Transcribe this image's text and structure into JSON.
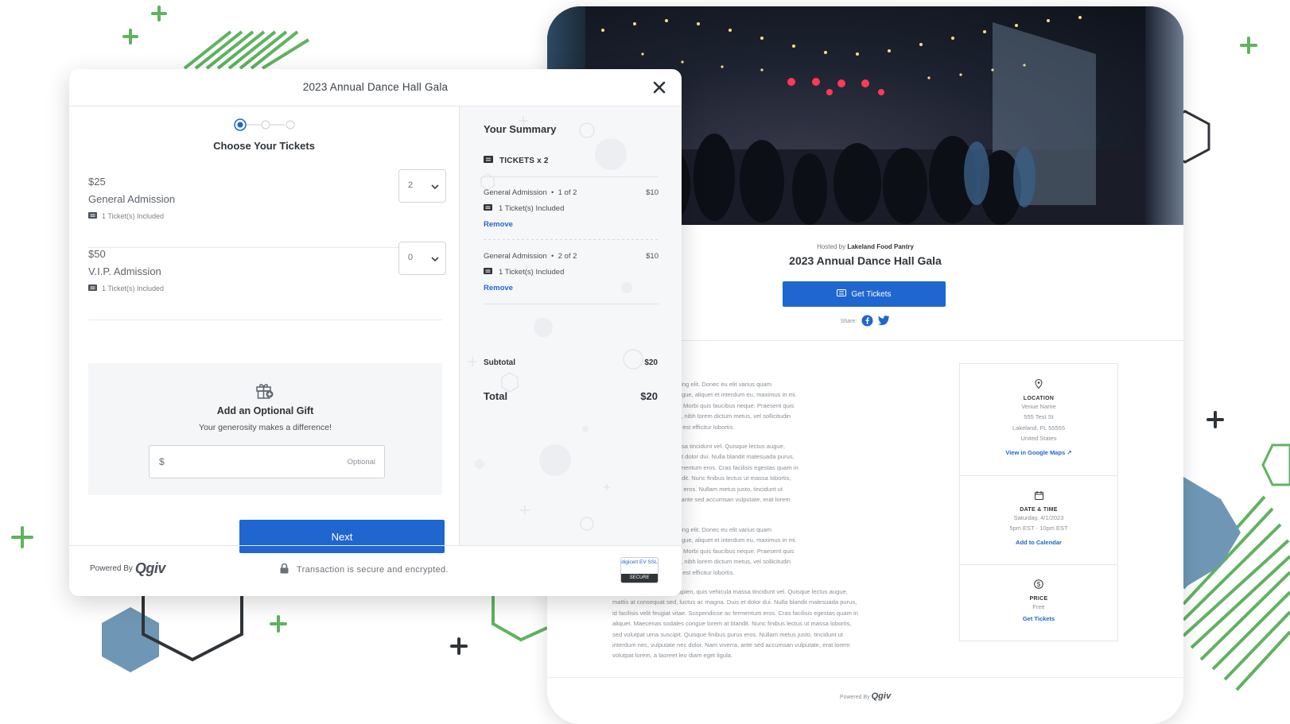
{
  "colors": {
    "accent": "#1f66d1",
    "green_deco": "#5fb35f",
    "hex_blue": "#6f97b5"
  },
  "event_page": {
    "hosted_prefix": "Hosted by",
    "host_name": "Lakeland Food Pantry",
    "title": "2023 Annual Dance Hall Gala",
    "get_tickets_label": "Get Tickets",
    "share_label": "Share:",
    "body_paragraphs": [
      [
        "amet, consectetur adipiscing elit. Donec eu elit varius quam",
        "eu ac metus. Duis velit augue, aliquet et interdum eu, maximus in mi.",
        "is non imperdiet convallis. Morbi quis faucibus neque. Praesent quis",
        "n, elit a auctor vestibulum, nibh lorem dictum metus, vel sollicitudin",
        "n. Cras pretium ligula nec est efficitur lobortis."
      ],
      [
        "sapien, quis vehicula massa tincidunt vel. Quisque lectus augue,",
        "l, luctus ac magna. Duis et dolor dui. Nulla blandit malesuada purus,",
        "vitae. Suspendisse ac fermentum eros. Cras facilisis egestas quam in",
        "ales congue lorem at blandit. Nunc finibus lectus ut massa lobortis,",
        "ipit. Quisque finibus purus eros. Nullam metus justo, tincidunt ut",
        "e nec dolor. Nam viverra, ante sed accumsan vulputate, erat lorem",
        "et leo diam eget ligula."
      ],
      [
        "amet, consectetur adipiscing elit. Donec eu elit varius quam",
        "eu ac metus. Duis velit augue, aliquet et interdum eu, maximus in mi.",
        "is non imperdiet convallis. Morbi quis faucibus neque. Praesent quis",
        "n, elit a auctor vestibulum, nibh lorem dictum metus, vel sollicitudin",
        "n. Cras pretium ligula nec est efficitur lobortis."
      ],
      [
        "Etiam volutpat aliquam sapien, quis vehicula massa tincidunt vel. Quisque lectus augue,",
        "mattis at consequat sed, luctus ac magna. Duis et dolor dui. Nulla blandit malesuada purus,",
        "id facilisis velit feugiat vitae. Suspendisse ac fermentum eros. Cras facilisis egestas quam in",
        "aliquet. Maecenas sodales congue lorem at blandit. Nunc finibus lectus ut massa lobortis,",
        "sed volutpat urna suscipit. Quisque finibus purus eros. Nullam metus justo, tincidunt ut",
        "interdum nec, vulputate nec dolor. Nam viverra, ante sed accumsan vulputate, erat lorem",
        "volutpat lorem, a laoreet leo diam eget ligula."
      ]
    ],
    "location": {
      "label": "LOCATION",
      "lines": [
        "Venue Name",
        "555 Test St",
        "Lakeland, FL 55555",
        "United States"
      ],
      "link": "View in Google Maps"
    },
    "datetime": {
      "label": "DATE & TIME",
      "lines": [
        "Saturday, 4/1/2023",
        "5pm EST - 10pm EST"
      ],
      "link": "Add to Calendar"
    },
    "price": {
      "label": "PRICE",
      "lines": [
        "Free"
      ],
      "link": "Get Tickets"
    },
    "footer_powered": "Powered By",
    "footer_brand": "Qgiv"
  },
  "modal": {
    "title": "2023 Annual Dance Hall Gala",
    "step_title": "Choose Your Tickets",
    "tickets": [
      {
        "price": "$25",
        "name": "General Admission",
        "included": "1 Ticket(s) Included",
        "qty": "2"
      },
      {
        "price": "$50",
        "name": "V.I.P. Admission",
        "included": "1 Ticket(s) Included",
        "qty": "0"
      }
    ],
    "gift": {
      "title": "Add an Optional Gift",
      "subtitle": "Your generosity makes a difference!",
      "currency": "$",
      "placeholder": "Optional"
    },
    "next_label": "Next",
    "summary": {
      "title": "Your Summary",
      "tickets_header": "TICKETS x 2",
      "items": [
        {
          "name": "General Admission",
          "of": "1 of 2",
          "price": "$10",
          "included": "1 Ticket(s) Included",
          "remove": "Remove"
        },
        {
          "name": "General Admission",
          "of": "2 of 2",
          "price": "$10",
          "included": "1 Ticket(s) Included",
          "remove": "Remove"
        }
      ],
      "subtotal_label": "Subtotal",
      "subtotal_value": "$20",
      "total_label": "Total",
      "total_value": "$20"
    },
    "footer": {
      "powered_by": "Powered By",
      "brand": "Qgiv",
      "secure_text": "Transaction is secure and encrypted.",
      "badge_top": "digicert EV SSL",
      "badge_bottom": "SECURE"
    }
  }
}
